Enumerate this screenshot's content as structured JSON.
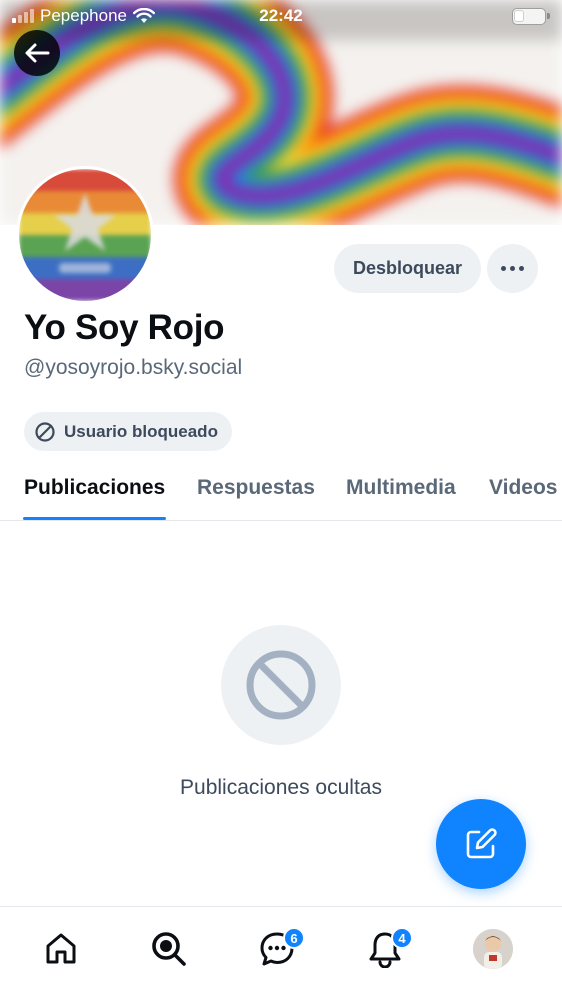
{
  "status_bar": {
    "carrier": "Pepephone",
    "time": "22:42"
  },
  "profile": {
    "display_name": "Yo Soy Rojo",
    "handle": "@yosoyrojo.bsky.social",
    "unblock_label": "Desbloquear",
    "blocked_badge_label": "Usuario bloqueado"
  },
  "tabs": [
    {
      "label": "Publicaciones",
      "active": true
    },
    {
      "label": "Respuestas",
      "active": false
    },
    {
      "label": "Multimedia",
      "active": false
    },
    {
      "label": "Videos",
      "active": false
    }
  ],
  "empty_state": {
    "message": "Publicaciones ocultas",
    "icon": "block-icon"
  },
  "bottom_nav": {
    "chat_badge": "6",
    "notifications_badge": "4"
  },
  "colors": {
    "accent": "#1083fe",
    "text_primary": "#0b0f14",
    "text_secondary": "#5a6878",
    "chip_bg": "#eef1f4"
  }
}
